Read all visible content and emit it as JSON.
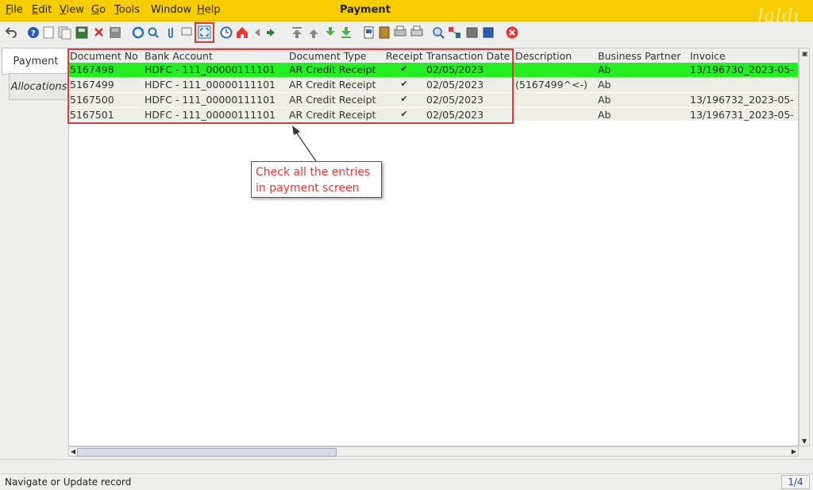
{
  "window": {
    "title": "Payment",
    "watermark": "Jaldi"
  },
  "menu": {
    "file": {
      "mnemonic": "F",
      "rest": "ile"
    },
    "edit": {
      "mnemonic": "E",
      "rest": "dit"
    },
    "view": {
      "mnemonic": "V",
      "rest": "iew"
    },
    "go": {
      "mnemonic": "G",
      "rest": "o"
    },
    "tools": {
      "mnemonic": "T",
      "rest": "ools"
    },
    "window": "Window",
    "help": {
      "mnemonic": "H",
      "rest": "elp"
    }
  },
  "toolbar": {
    "icons": [
      "undo-icon",
      "help-icon",
      "new-icon",
      "copy-icon",
      "save-new-icon",
      "delete-icon",
      "save-icon",
      "refresh-icon",
      "find-icon",
      "attachment-icon",
      "chat-icon",
      "grid-toggle-icon",
      "history-icon",
      "home-icon",
      "back-icon",
      "forward-icon",
      "first-record-icon",
      "previous-record-icon",
      "next-record-icon",
      "last-record-icon",
      "report-icon",
      "archive-icon",
      "print-preview-icon",
      "print-icon",
      "zoom-icon",
      "workflow-icon",
      "request-icon",
      "product-icon",
      "close-icon"
    ]
  },
  "tabs": [
    "Payment",
    "Allocations"
  ],
  "grid": {
    "columns": [
      "Document No",
      "Bank Account",
      "Document Type",
      "Receipt",
      "Transaction Date",
      "Description",
      "Business Partner",
      "Invoice"
    ],
    "rows": [
      {
        "doc": "5167498",
        "bank": "HDFC - 111_00000111101",
        "type": "AR Credit Receipt",
        "receipt": "✔",
        "date": "02/05/2023",
        "desc": "",
        "bp": "Ab",
        "invoice": "13/196730_2023-05-"
      },
      {
        "doc": "5167499",
        "bank": "HDFC - 111_00000111101",
        "type": "AR Credit Receipt",
        "receipt": "✔",
        "date": "02/05/2023",
        "desc": "(5167499^<-)",
        "bp": "Ab",
        "invoice": ""
      },
      {
        "doc": "5167500",
        "bank": "HDFC - 111_00000111101",
        "type": "AR Credit Receipt",
        "receipt": "✔",
        "date": "02/05/2023",
        "desc": "",
        "bp": "Ab",
        "invoice": "13/196732_2023-05-"
      },
      {
        "doc": "5167501",
        "bank": "HDFC - 111_00000111101",
        "type": "AR Credit Receipt",
        "receipt": "✔",
        "date": "02/05/2023",
        "desc": "",
        "bp": "Ab",
        "invoice": "13/196731_2023-05-"
      }
    ]
  },
  "callout": {
    "line1": "Check all the entries",
    "line2": "in payment screen"
  },
  "status": {
    "text": "Navigate or Update record",
    "count": "1/4"
  },
  "colors": {
    "menubar": "#f7cd00",
    "selected_row": "#22ee22",
    "annotation": "#e53935"
  }
}
